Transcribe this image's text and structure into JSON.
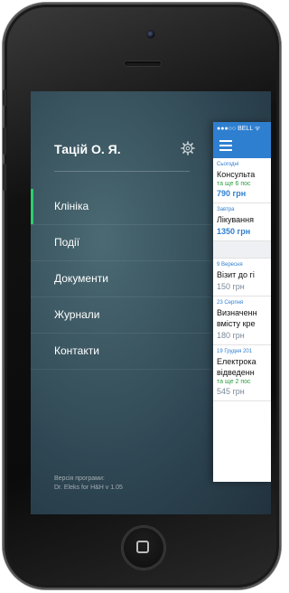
{
  "menu": {
    "user_name": "Тацій О. Я.",
    "settings_icon": "gear-icon",
    "items": [
      {
        "label": "Клініка",
        "active": true
      },
      {
        "label": "Події",
        "active": false
      },
      {
        "label": "Документи",
        "active": false
      },
      {
        "label": "Журнали",
        "active": false
      },
      {
        "label": "Контакти",
        "active": false
      }
    ],
    "version_line1": "Версія програми:",
    "version_line2": "Dr. Eleks for H&H v 1.05",
    "active_color": "#2ecc71"
  },
  "panel": {
    "status_text": "●●●○○ BELL ᯤ",
    "menu_icon": "hamburger-icon",
    "accent_color": "#2f7fd0",
    "appointments": [
      {
        "date": "Сьогодні",
        "title": "Консульта",
        "more": "та ще 6 пос",
        "price": "790 грн"
      },
      {
        "date": "Завтра",
        "title": "Лікування",
        "price": "1350 грн"
      },
      {
        "date": "9 Вересня",
        "title": "Візит до гі",
        "price": "150 грн"
      },
      {
        "date": "23 Серпня",
        "title": "Визначенн",
        "title2": "вмісту кре",
        "price": "180 грн"
      },
      {
        "date": "19 Грудня 201",
        "title": "Електрока",
        "title2": "відведенн",
        "more": "та ще 2 пос",
        "price": "545 грн"
      }
    ]
  }
}
